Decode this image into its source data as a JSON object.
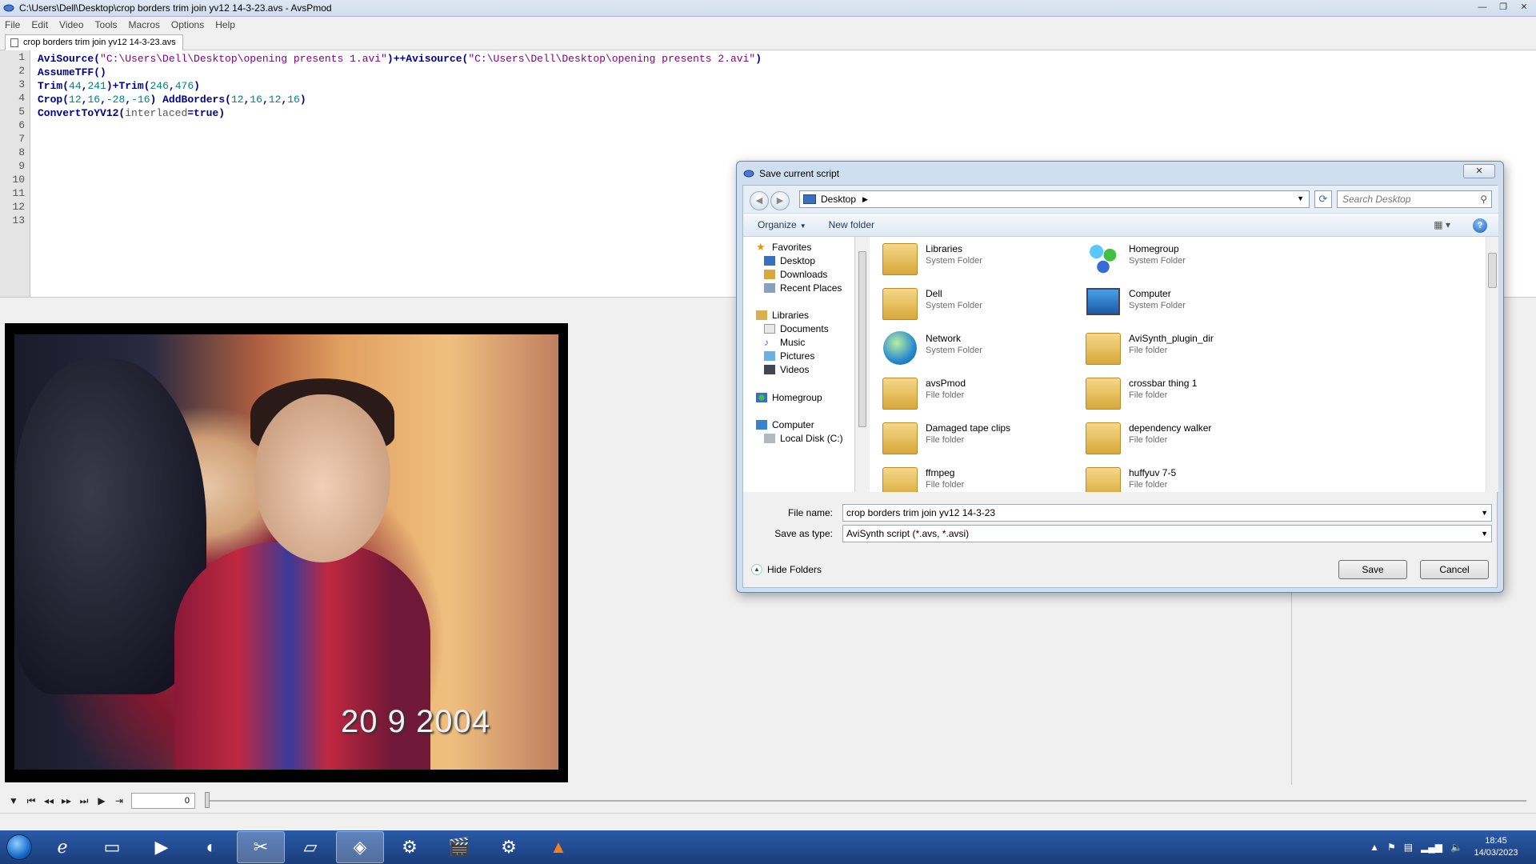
{
  "window": {
    "title": "C:\\Users\\Dell\\Desktop\\crop borders trim join yv12 14-3-23.avs - AvsPmod"
  },
  "menu": [
    "File",
    "Edit",
    "Video",
    "Tools",
    "Macros",
    "Options",
    "Help"
  ],
  "tab": {
    "label": "crop borders trim join yv12 14-3-23.avs"
  },
  "editor": {
    "line_numbers": [
      "1",
      "2",
      "3",
      "4",
      "5",
      "6",
      "7",
      "8",
      "9",
      "10",
      "11",
      "12",
      "13"
    ],
    "lines": [
      [
        {
          "t": "AviSource",
          "c": "kw"
        },
        {
          "t": "(",
          "c": "kw"
        },
        {
          "t": "\"C:\\Users\\Dell\\Desktop\\opening presents 1.avi\"",
          "c": "str"
        },
        {
          "t": ")++",
          "c": "kw"
        },
        {
          "t": "Avisource",
          "c": "kw"
        },
        {
          "t": "(",
          "c": "kw"
        },
        {
          "t": "\"C:\\Users\\Dell\\Desktop\\opening presents 2.avi\"",
          "c": "str"
        },
        {
          "t": ")",
          "c": "kw"
        }
      ],
      [
        {
          "t": "AssumeTFF()",
          "c": "kw"
        }
      ],
      [
        {
          "t": "Trim",
          "c": "kw"
        },
        {
          "t": "(",
          "c": "kw"
        },
        {
          "t": "44",
          "c": "num"
        },
        {
          "t": ",",
          "c": "kw"
        },
        {
          "t": "241",
          "c": "num"
        },
        {
          "t": ")+",
          "c": "kw"
        },
        {
          "t": "Trim",
          "c": "kw"
        },
        {
          "t": "(",
          "c": "kw"
        },
        {
          "t": "246",
          "c": "num"
        },
        {
          "t": ",",
          "c": "kw"
        },
        {
          "t": "476",
          "c": "num"
        },
        {
          "t": ")",
          "c": "kw"
        }
      ],
      [
        {
          "t": "Crop",
          "c": "kw"
        },
        {
          "t": "(",
          "c": "kw"
        },
        {
          "t": "12",
          "c": "num"
        },
        {
          "t": ",",
          "c": "kw"
        },
        {
          "t": "16",
          "c": "num"
        },
        {
          "t": ",",
          "c": "kw"
        },
        {
          "t": "-28",
          "c": "num"
        },
        {
          "t": ",",
          "c": "kw"
        },
        {
          "t": "-16",
          "c": "num"
        },
        {
          "t": ") ",
          "c": "kw"
        },
        {
          "t": "AddBorders",
          "c": "kw"
        },
        {
          "t": "(",
          "c": "kw"
        },
        {
          "t": "12",
          "c": "num"
        },
        {
          "t": ",",
          "c": "kw"
        },
        {
          "t": "16",
          "c": "num"
        },
        {
          "t": ",",
          "c": "kw"
        },
        {
          "t": "12",
          "c": "num"
        },
        {
          "t": ",",
          "c": "kw"
        },
        {
          "t": "16",
          "c": "num"
        },
        {
          "t": ")",
          "c": "kw"
        }
      ],
      [
        {
          "t": "ConvertToYV12",
          "c": "kw"
        },
        {
          "t": "(",
          "c": "kw"
        },
        {
          "t": "interlaced",
          "c": "arg"
        },
        {
          "t": "=true)",
          "c": "kw"
        }
      ]
    ]
  },
  "video": {
    "datestamp": "20   9 2004"
  },
  "playback": {
    "frame": "0"
  },
  "dialog": {
    "title": "Save current script",
    "close": "✕",
    "address": "Desktop",
    "search_placeholder": "Search Desktop",
    "organize": "Organize",
    "new_folder": "New folder",
    "nav": {
      "favorites": "Favorites",
      "desktop": "Desktop",
      "downloads": "Downloads",
      "recent": "Recent Places",
      "libraries": "Libraries",
      "documents": "Documents",
      "music": "Music",
      "pictures": "Pictures",
      "videos": "Videos",
      "homegroup": "Homegroup",
      "computer": "Computer",
      "local_disk": "Local Disk (C:)"
    },
    "files": [
      {
        "name": "Libraries",
        "type": "System Folder"
      },
      {
        "name": "Homegroup",
        "type": "System Folder"
      },
      {
        "name": "Dell",
        "type": "System Folder"
      },
      {
        "name": "Computer",
        "type": "System Folder"
      },
      {
        "name": "Network",
        "type": "System Folder"
      },
      {
        "name": "AviSynth_plugin_dir",
        "type": "File folder"
      },
      {
        "name": "avsPmod",
        "type": "File folder"
      },
      {
        "name": "crossbar thing 1",
        "type": "File folder"
      },
      {
        "name": "Damaged tape clips",
        "type": "File folder"
      },
      {
        "name": "dependency walker",
        "type": "File folder"
      },
      {
        "name": "ffmpeg",
        "type": "File folder"
      },
      {
        "name": "huffyuv 7-5",
        "type": "File folder"
      }
    ],
    "file_name_label": "File name:",
    "file_name_value": "crop borders trim join yv12 14-3-23",
    "save_type_label": "Save as type:",
    "save_type_value": "AviSynth script (*.avs, *.avsi)",
    "hide_folders": "Hide Folders",
    "save": "Save",
    "cancel": "Cancel"
  },
  "taskbar": {
    "time": "18:45",
    "date": "14/03/2023"
  }
}
